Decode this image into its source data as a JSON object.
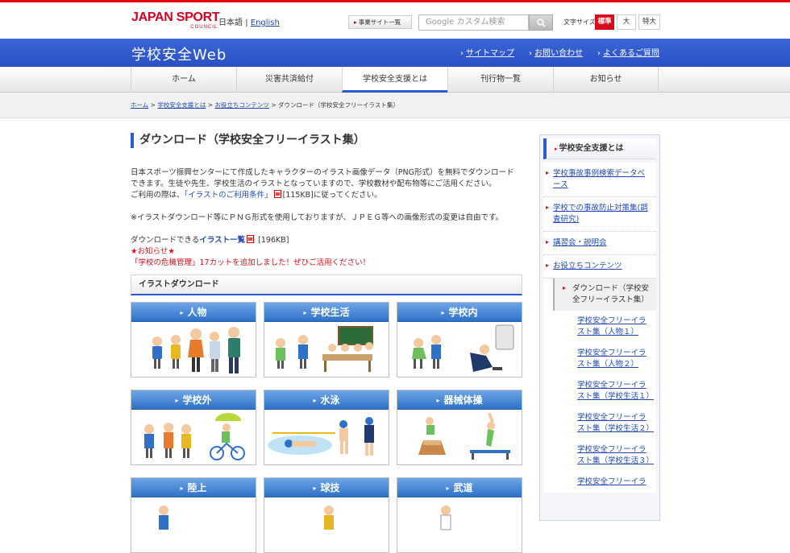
{
  "header": {
    "logo_line1": "JAPAN SPORT",
    "logo_line2": "COUNCIL",
    "lang_ja": "日本語",
    "lang_sep": "|",
    "lang_en": "English",
    "jigyou_label": "事業サイト一覧",
    "search_placeholder": "Google カスタム検索",
    "fontsize_label": "文字サイズ",
    "fontsize_options": [
      "標準",
      "大",
      "特大"
    ]
  },
  "bluebar": {
    "site_title": "学校安全Web",
    "links": [
      "サイトマップ",
      "お問い合わせ",
      "よくあるご質問"
    ]
  },
  "gnav": [
    "ホーム",
    "災害共済給付",
    "学校安全支援とは",
    "刊行物一覧",
    "お知らせ"
  ],
  "breadcrumb": {
    "items": [
      "ホーム",
      "学校安全支援とは",
      "お役立ちコンテンツ"
    ],
    "current": "ダウンロード（学校安全フリーイラスト集）",
    "sep": ">"
  },
  "main": {
    "title": "ダウンロード（学校安全フリーイラスト集）",
    "para1_line1": "日本スポーツ振興センターにて作成したキャラクターのイラスト画像データ（PNG形式）を無料でダウンロード",
    "para1_line2": "できます。生徒や先生、学校生活のイラストとなっていますので、学校教材や配布物等にご活用ください。",
    "para1_line3_pre": "ご利用の際は、",
    "para1_link": "「イラストのご利用条件」",
    "para1_line3_post": "[115KB]に従ってください。",
    "para2": "※イラストダウンロード等にＰＮＧ形式を使用しておりますが、ＪＰＥＧ等への画像形式の変更は自由です。",
    "dl_pre": "ダウンロードできる",
    "dl_link": "イラスト一覧",
    "dl_size": "[196KB]",
    "notice_title": "★お知らせ★",
    "notice_text": "「学校の危機管理」17カットを追加しました！ぜひご活用ください！",
    "section_title": "イラストダウンロード",
    "tiles": [
      "人物",
      "学校生活",
      "学校内",
      "学校外",
      "水泳",
      "器械体操",
      "陸上",
      "球技",
      "武道"
    ]
  },
  "sidebar": {
    "title": "学校安全支援とは",
    "items": [
      "学校事故事例検索データベース",
      "学校での事故防止対策集(調査研究)",
      "講習会・説明会",
      "お役立ちコンテンツ"
    ],
    "current": "ダウンロード（学校安全フリーイラスト集）",
    "subitems": [
      "学校安全フリーイラスト集（人物１）",
      "学校安全フリーイラスト集（人物２）",
      "学校安全フリーイラスト集（学校生活１）",
      "学校安全フリーイラスト集（学校生活２）",
      "学校安全フリーイラスト集（学校生活３）",
      "学校安全フリーイラ"
    ]
  },
  "colors": {
    "brand_red": "#d80c18",
    "brand_blue": "#2e5ad0",
    "tile_header": "#2f71c9"
  }
}
